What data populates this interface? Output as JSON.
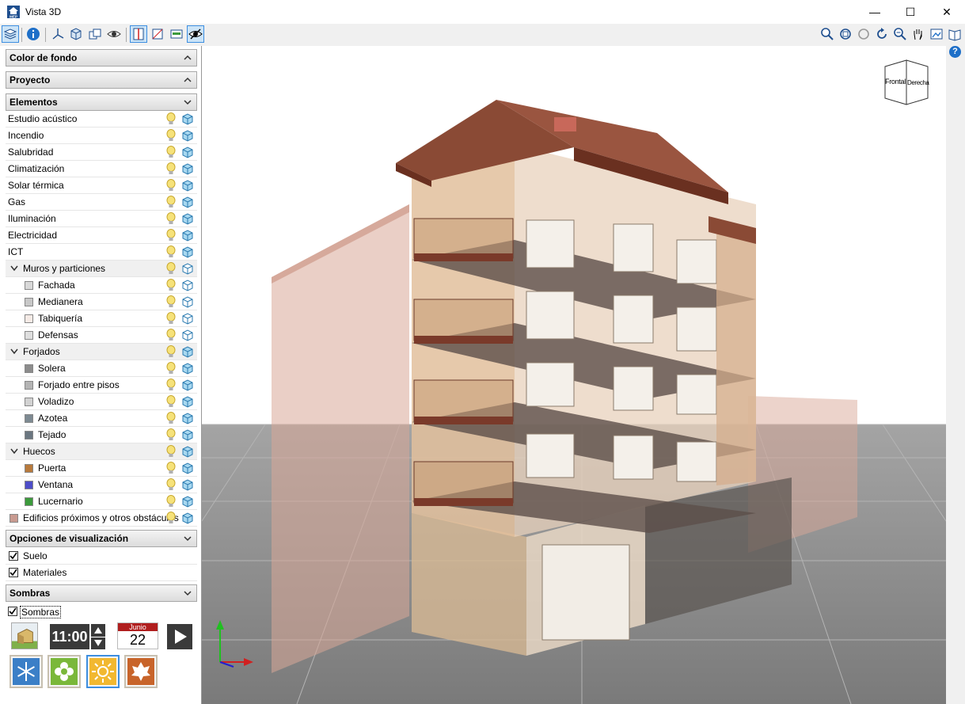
{
  "window": {
    "title": "Vista 3D",
    "minimize": "—",
    "maximize": "☐",
    "close": "✕",
    "app_icon_text": "MEP"
  },
  "panels": {
    "color_fondo": "Color de fondo",
    "proyecto": "Proyecto",
    "elementos": "Elementos",
    "opciones": "Opciones de visualización",
    "sombras": "Sombras"
  },
  "elements": [
    {
      "label": "Estudio acústico",
      "level": 0
    },
    {
      "label": "Incendio",
      "level": 0
    },
    {
      "label": "Salubridad",
      "level": 0
    },
    {
      "label": "Climatización",
      "level": 0
    },
    {
      "label": "Solar térmica",
      "level": 0
    },
    {
      "label": "Gas",
      "level": 0
    },
    {
      "label": "Iluminación",
      "level": 0
    },
    {
      "label": "Electricidad",
      "level": 0
    },
    {
      "label": "ICT",
      "level": 0
    },
    {
      "label": "Muros y particiones",
      "level": "group"
    },
    {
      "label": "Fachada",
      "level": 1,
      "color": "#d8d8d8"
    },
    {
      "label": "Medianera",
      "level": 1,
      "color": "#c8c8c8"
    },
    {
      "label": "Tabiquería",
      "level": 1,
      "color": "#f5ebe6"
    },
    {
      "label": "Defensas",
      "level": 1,
      "color": "#dedede"
    },
    {
      "label": "Forjados",
      "level": "group"
    },
    {
      "label": "Solera",
      "level": 1,
      "color": "#8c8c8c"
    },
    {
      "label": "Forjado entre pisos",
      "level": 1,
      "color": "#b4b4b4"
    },
    {
      "label": "Voladizo",
      "level": 1,
      "color": "#d2d2d2"
    },
    {
      "label": "Azotea",
      "level": 1,
      "color": "#7d8a92"
    },
    {
      "label": "Tejado",
      "level": 1,
      "color": "#6a7680"
    },
    {
      "label": "Huecos",
      "level": "group"
    },
    {
      "label": "Puerta",
      "level": 1,
      "color": "#b87a3c"
    },
    {
      "label": "Ventana",
      "level": 1,
      "color": "#4d4dc8"
    },
    {
      "label": "Lucernario",
      "level": 1,
      "color": "#3c9a3c"
    },
    {
      "label": "Edificios próximos y otros obstáculos",
      "level": 0,
      "color": "#c89a90"
    }
  ],
  "options": {
    "suelo": "Suelo",
    "materiales": "Materiales",
    "sombras": "Sombras"
  },
  "shadows": {
    "time": "11:00",
    "month": "Junio",
    "day": "22"
  },
  "viewcube": {
    "front": "Frontal",
    "right": "Derecha"
  },
  "help_icon_text": "?",
  "colors": {
    "accent": "#3d8ee0",
    "roof": "#8a4a35",
    "wall": "#e6c4a8",
    "ground": "#8e8e8e"
  }
}
